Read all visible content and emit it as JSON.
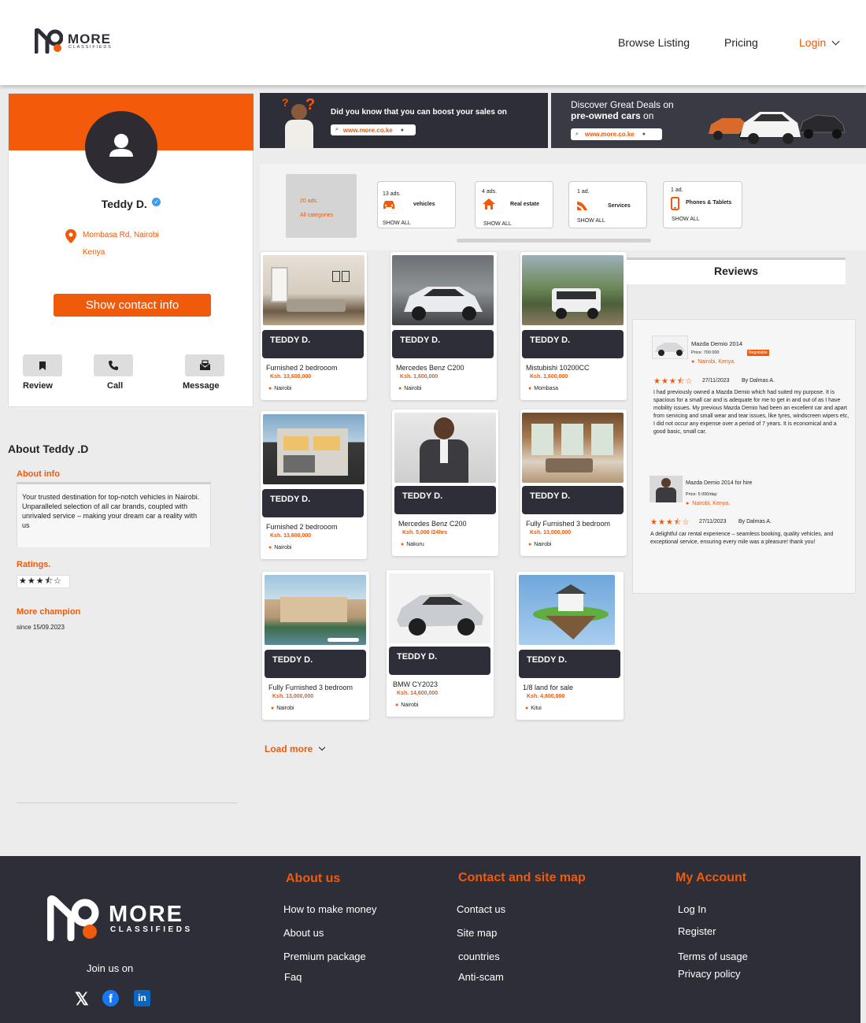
{
  "header": {
    "logo_word": "MORE",
    "logo_sub": "CLASSIFIEDS",
    "nav": {
      "browse": "Browse Listing",
      "pricing": "Pricing",
      "login": "Login"
    }
  },
  "profile": {
    "name": "Teddy D.",
    "address_line1": "Mombasa Rd, Nairobi",
    "address_line2": "Kenya",
    "contact_button": "Show contact info",
    "actions": {
      "review": "Review",
      "call": "Call",
      "message": "Message"
    }
  },
  "banners": {
    "left_text": "Did you know that you can boost your sales on",
    "left_url": "www.more.co.ke",
    "right_line1": "Discover Great Deals on",
    "right_line2_bold": "pre-owned cars",
    "right_line2_rest": " on",
    "right_url": "www.more.co.ke"
  },
  "categories": {
    "all": {
      "count": "20 ads.",
      "label": "All categories"
    },
    "items": [
      {
        "count": "13 ads.",
        "name": "vehicles",
        "show": "SHOW ALL",
        "icon": "car-icon"
      },
      {
        "count": "4 ads.",
        "name": "Real estate",
        "show": "SHOW ALL",
        "icon": "house-icon"
      },
      {
        "count": "1 ad.",
        "name": "Services",
        "show": "SHOW ALL",
        "icon": "services-icon"
      },
      {
        "count": "1 ad.",
        "name": "Phones & Tablets",
        "show": "SHOW ALL",
        "icon": "phone-icon"
      }
    ]
  },
  "listings": [
    {
      "seller": "TEDDY D.",
      "title": "Furnished 2 bedrooom",
      "price": "Ksh. 13,600,000",
      "location": "Nairobi"
    },
    {
      "seller": "TEDDY D.",
      "title": "Mercedes Benz C200",
      "price": "Ksh. 1,600,000",
      "location": "Nairobi"
    },
    {
      "seller": "TEDDY D.",
      "title": "Mistubishi 10200CC",
      "price": "Ksh. 1,600,000",
      "location": "Mombasa"
    },
    {
      "seller": "TEDDY D.",
      "title": "Furnished 2 bedrooom",
      "price": "Ksh. 13,600,000",
      "location": "Nairobi"
    },
    {
      "seller": "TEDDY D.",
      "title": "Mercedes Benz C200",
      "price": "Ksh. 5,000 /24hrs",
      "location": "Nakuru"
    },
    {
      "seller": "TEDDY D.",
      "title": "Fully Furnished 3 bedroom",
      "price": "Ksh. 13,000,000",
      "location": "Nairobi"
    },
    {
      "seller": "TEDDY D.",
      "title": "Fully Furnished 3 bedroom",
      "price": "Ksh. 13,000,000",
      "location": "Nairobi"
    },
    {
      "seller": "TEDDY D.",
      "title": "BMW CY2023",
      "price": "Ksh. 14,600,000",
      "location": "Nairobi"
    },
    {
      "seller": "TEDDY D.",
      "title": "1/8 land for sale",
      "price": "Ksh. 4,800,000",
      "location": "Kitui"
    }
  ],
  "load_more": "Load more",
  "reviews": {
    "heading": "Reviews",
    "items": [
      {
        "title": "Mazda Demio 2014",
        "price": "Price: 700 000",
        "badge": "Negotiable",
        "location": "Nairobi, Kenya.",
        "rating": 3.5,
        "date": "27/11/2023",
        "author": "By Dalmas A.",
        "text": "I had previously owned a Mazda Demio which had suited my purpose. It is spacious for a small car and is adequate for me to get in and out of as I have mobility issues. My previous Mazda Demio had been an excellent car and apart from servicing and small wear and tear issues, like tyres, windscreen wipers etc, I did not occur any expense over a period of 7 years. It is economical and a good basic, small car."
      },
      {
        "title": "Mazda Demio 2014 for hire",
        "price": "Price: 5 000/day",
        "badge": "",
        "location": "Nairobi, Kenya.",
        "rating": 3.5,
        "date": "27/11/2023",
        "author": "By Dalmas A.",
        "text": "A delightful car rental experience – seamless booking, quality vehicles, and exceptional service, ensuring every mile was a pleasure! thank you!"
      }
    ]
  },
  "about": {
    "heading": "About Teddy .D",
    "info_label": "About info",
    "info_text": "Your trusted destination for top-notch vehicles in Nairobi. Unparalleled selection of all car brands, coupled with unrivaled service – making your dream car a reality with us",
    "ratings_label": "Ratings.",
    "rating": 3.5,
    "champion_label": "More champion",
    "champion_since": "since 15/09.2023"
  },
  "footer": {
    "logo_word": "MORE",
    "logo_sub": "CLASSIFIEDS",
    "join": "Join us on",
    "col1": {
      "title": "About us",
      "links": [
        "How to make money",
        "About us",
        "Premium package",
        "Faq"
      ]
    },
    "col2": {
      "title": "Contact and site map",
      "links": [
        "Contact us",
        "Site map",
        "countries",
        "Anti-scam"
      ]
    },
    "col3": {
      "title": "My Account",
      "links": [
        "Log In",
        "Register",
        "Terms of usage",
        "Privacy policy"
      ]
    }
  },
  "colors": {
    "accent": "#ef5a0b",
    "dark": "#2e2e38"
  }
}
